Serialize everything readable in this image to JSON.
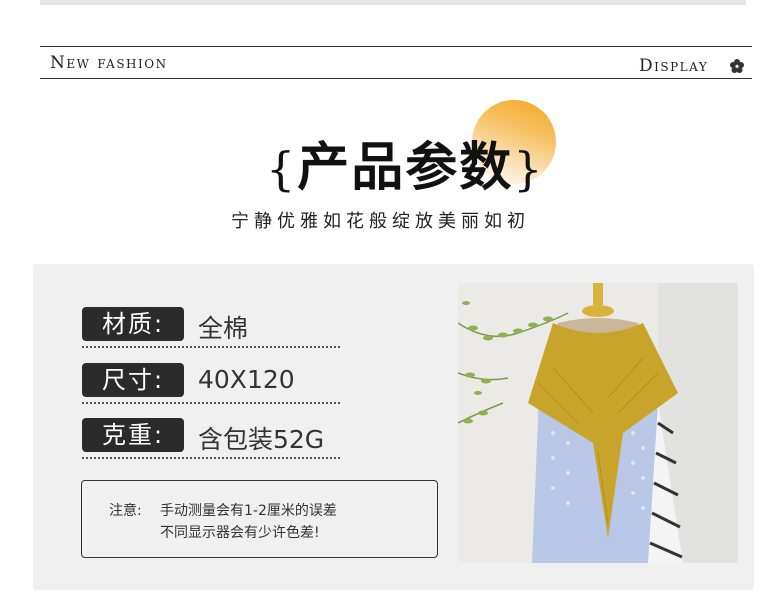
{
  "banner": {
    "left_text": "New fashion",
    "right_text": "Display",
    "icon": "flower-icon"
  },
  "heading": {
    "brace_open": "{",
    "title": "产品参数",
    "brace_close": "}",
    "subtitle": "宁静优雅如花般绽放美丽如初"
  },
  "specs": [
    {
      "label": "材质:",
      "value": "全棉"
    },
    {
      "label": "尺寸:",
      "value": "40X120"
    },
    {
      "label": "克重:",
      "value": "含包装52G"
    }
  ],
  "note": {
    "prefix": "注意:",
    "line1": "手动测量会有1-2厘米的误差",
    "line2": "不同显示器会有少许色差!"
  },
  "photo": {
    "subject": "mannequin-with-yellow-lace-scarf",
    "colors": {
      "scarf": "#c9a42a",
      "top": "#b9c8e6",
      "gold_stand": "#d9b23a"
    }
  },
  "colors": {
    "accent": "#f4a41e",
    "label_bg": "#2b2b2b",
    "panel_bg": "#f0f0f0"
  }
}
